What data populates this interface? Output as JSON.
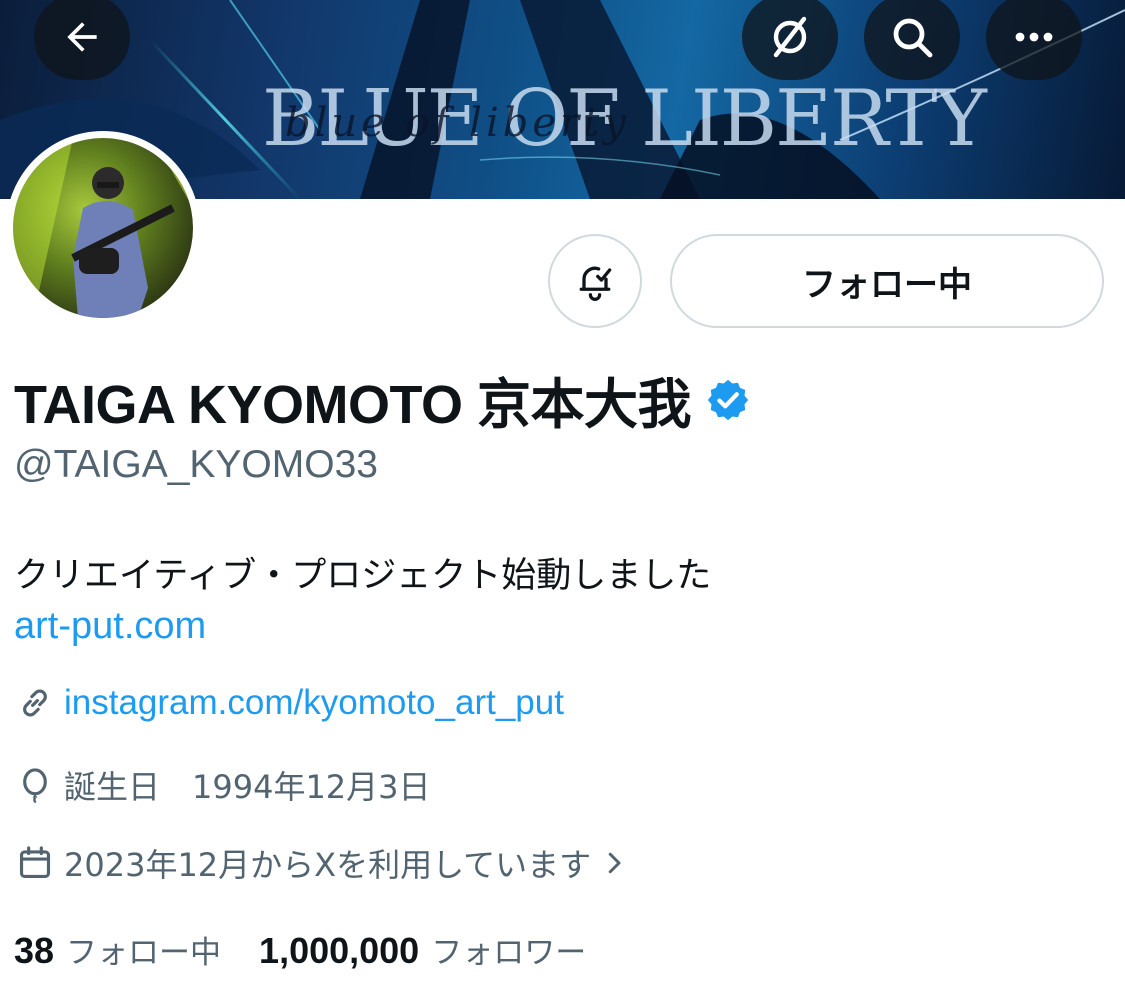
{
  "banner": {
    "title": "BLUE OF LIBERTY",
    "script_text": "blue of liberty"
  },
  "top_bar": {
    "back_icon": "arrow-left-icon",
    "grok_icon": "grok-icon",
    "search_icon": "search-icon",
    "more_icon": "more-horizontal-icon"
  },
  "profile": {
    "display_name": "TAIGA KYOMOTO 京本大我",
    "verified": true,
    "handle": "@TAIGA_KYOMO33",
    "bio": "クリエイティブ・プロジェクト始動しました",
    "bio_link": "art-put.com",
    "website": "instagram.com/kyomoto_art_put",
    "birthday": "誕生日　1994年12月3日",
    "joined": "2023年12月からXを利用しています",
    "follow_button_label": "フォロー中",
    "notification_icon": "bell-check-icon"
  },
  "stats": {
    "following_count": "38",
    "following_label": "フォロー中",
    "followers_count": "1,000,000",
    "followers_label": "フォロワー"
  },
  "colors": {
    "link": "#1d9bf0",
    "verified": "#1d9bf0",
    "secondary_text": "#536471",
    "primary_text": "#0f1419",
    "border": "#cfd9de"
  }
}
